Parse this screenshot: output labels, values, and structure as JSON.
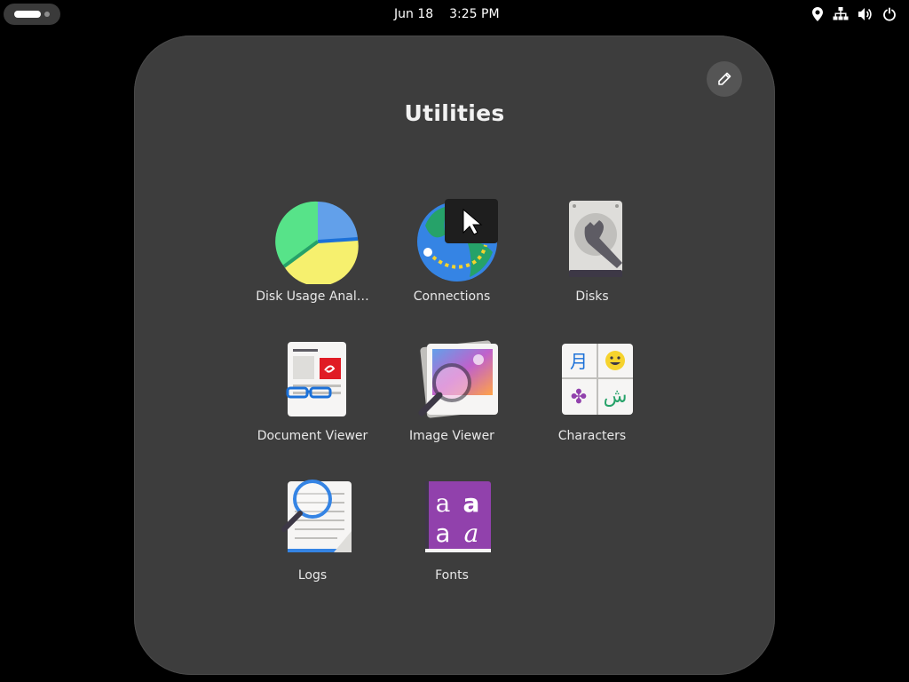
{
  "topbar": {
    "date": "Jun 18",
    "time": "3:25 PM",
    "tray_icons": [
      "location-icon",
      "network-icon",
      "volume-icon",
      "power-icon"
    ]
  },
  "folder": {
    "title": "Utilities",
    "edit_icon": "pencil-icon",
    "apps": [
      {
        "label": "Disk Usage Anal…",
        "icon": "disk-usage-analyzer-icon"
      },
      {
        "label": "Connections",
        "icon": "connections-icon"
      },
      {
        "label": "Disks",
        "icon": "disks-icon"
      },
      {
        "label": "Document Viewer",
        "icon": "document-viewer-icon"
      },
      {
        "label": "Image Viewer",
        "icon": "image-viewer-icon"
      },
      {
        "label": "Characters",
        "icon": "characters-icon"
      },
      {
        "label": "Logs",
        "icon": "logs-icon"
      },
      {
        "label": "Fonts",
        "icon": "fonts-icon"
      }
    ],
    "characters_glyphs": [
      "月",
      "☺",
      "✤",
      "ش"
    ],
    "fonts_glyphs": [
      "a",
      "a",
      "a",
      "a"
    ]
  },
  "colors": {
    "background": "#000000",
    "folder_bg": "#3d3d3d",
    "label": "#e8e8e8"
  }
}
